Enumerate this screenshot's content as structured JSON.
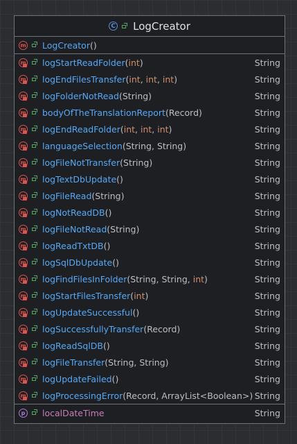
{
  "class_title": "LogCreator",
  "constructor": {
    "name": "LogCreator",
    "params": "()"
  },
  "methods": [
    {
      "name": "logStartReadFolder",
      "params": [
        [
          "(",
          ""
        ],
        [
          "int",
          "kw"
        ],
        [
          ")",
          ""
        ]
      ],
      "type": "String"
    },
    {
      "name": "logEndFilesTransfer",
      "params": [
        [
          "(",
          ""
        ],
        [
          "int",
          "kw"
        ],
        [
          ", ",
          ""
        ],
        [
          "int",
          "kw"
        ],
        [
          ", ",
          ""
        ],
        [
          "int",
          "kw"
        ],
        [
          ")",
          ""
        ]
      ],
      "type": "String"
    },
    {
      "name": "logFolderNotRead",
      "params": [
        [
          "(String)",
          ""
        ]
      ],
      "type": "String"
    },
    {
      "name": "bodyOfTheTranslationReport",
      "params": [
        [
          "(Record)",
          ""
        ]
      ],
      "type": "String"
    },
    {
      "name": "logEndReadFolder",
      "params": [
        [
          "(",
          ""
        ],
        [
          "int",
          "kw"
        ],
        [
          ", ",
          ""
        ],
        [
          "int",
          "kw"
        ],
        [
          ", ",
          ""
        ],
        [
          "int",
          "kw"
        ],
        [
          ")",
          ""
        ]
      ],
      "type": "String"
    },
    {
      "name": "languageSelection",
      "params": [
        [
          "(String, String)",
          ""
        ]
      ],
      "type": "String"
    },
    {
      "name": "logFileNotTransfer",
      "params": [
        [
          "(String)",
          ""
        ]
      ],
      "type": "String"
    },
    {
      "name": "logTextDbUpdate",
      "params": [
        [
          "()",
          ""
        ]
      ],
      "type": "String"
    },
    {
      "name": "logFileRead",
      "params": [
        [
          "(String)",
          ""
        ]
      ],
      "type": "String"
    },
    {
      "name": "logNotReadDB",
      "params": [
        [
          "()",
          ""
        ]
      ],
      "type": "String"
    },
    {
      "name": "logFileNotRead",
      "params": [
        [
          "(String)",
          ""
        ]
      ],
      "type": "String"
    },
    {
      "name": "logReadTxtDB",
      "params": [
        [
          "()",
          ""
        ]
      ],
      "type": "String"
    },
    {
      "name": "logSqlDbUpdate",
      "params": [
        [
          "()",
          ""
        ]
      ],
      "type": "String"
    },
    {
      "name": "logFindFilesInFolder",
      "params": [
        [
          "(String, String, ",
          ""
        ],
        [
          "int",
          "kw"
        ],
        [
          ")",
          ""
        ]
      ],
      "type": "String"
    },
    {
      "name": "logStartFilesTransfer",
      "params": [
        [
          "(",
          ""
        ],
        [
          "int",
          "kw"
        ],
        [
          ")",
          ""
        ]
      ],
      "type": "String"
    },
    {
      "name": "logUpdateSuccessful",
      "params": [
        [
          "()",
          ""
        ]
      ],
      "type": "String"
    },
    {
      "name": "logSuccessfullyTransfer",
      "params": [
        [
          "(Record)",
          ""
        ]
      ],
      "type": "String"
    },
    {
      "name": "logReadSqlDB",
      "params": [
        [
          "()",
          ""
        ]
      ],
      "type": "String"
    },
    {
      "name": "logFileTransfer",
      "params": [
        [
          "(String, String)",
          ""
        ]
      ],
      "type": "String"
    },
    {
      "name": "logUpdateFailed",
      "params": [
        [
          "()",
          ""
        ]
      ],
      "type": "String"
    },
    {
      "name": "logProcessingError",
      "params": [
        [
          "(Record, ArrayList<Boolean>)",
          ""
        ]
      ],
      "type": "String"
    }
  ],
  "fields": [
    {
      "name": "localDateTime",
      "type": "String"
    }
  ],
  "icons": {
    "class": "class-icon",
    "method": "method-icon",
    "private_method": "private-method-icon",
    "property": "property-icon",
    "public": "public-visibility-icon"
  },
  "colors": {
    "method_name": "#56a8f5",
    "field_name": "#c77dbb",
    "keyword": "#cf8e6d",
    "text": "#bcbec4",
    "border": "#6f737a",
    "method_icon": "#d9534f",
    "property_icon": "#a97bd8",
    "class_icon": "#5c8bd6"
  }
}
